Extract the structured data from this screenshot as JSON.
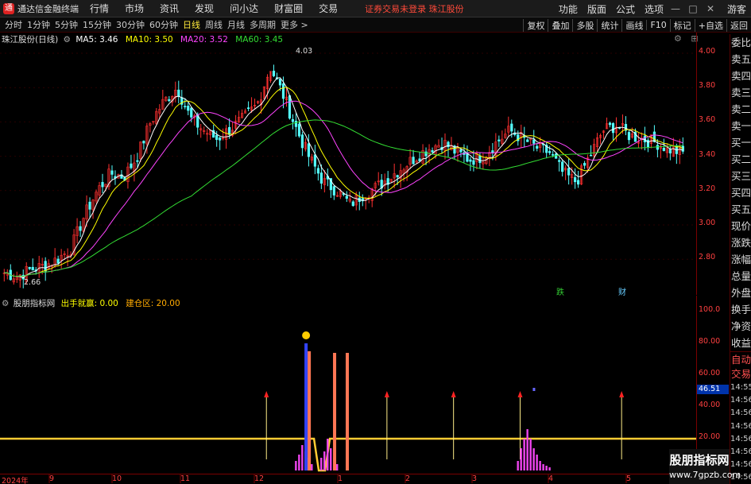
{
  "menubar": {
    "app_title": "通达信金融终端",
    "menus": [
      "行情",
      "市场",
      "资讯",
      "发现",
      "问小达",
      "财富圈",
      "交易"
    ],
    "warning": "证券交易未登录  珠江股份",
    "right_menus": [
      "功能",
      "版面",
      "公式",
      "选项",
      "游客"
    ],
    "window_buttons": [
      "—",
      "□",
      "✕"
    ]
  },
  "toolbar": {
    "periods": [
      "分时",
      "1分钟",
      "5分钟",
      "15分钟",
      "30分钟",
      "60分钟",
      "日线",
      "周线",
      "月线",
      "多周期",
      "更多 >"
    ],
    "active_period": "日线",
    "tools": [
      "复权",
      "叠加",
      "多股",
      "统计",
      "画线",
      "F10",
      "标记",
      "+自选",
      "返回"
    ]
  },
  "main_chart": {
    "stock_label": "珠江股份(日线)",
    "ma": [
      {
        "label": "MA5: 3.46",
        "color": "#ffffff"
      },
      {
        "label": "MA10: 3.50",
        "color": "#ffff00"
      },
      {
        "label": "MA20: 3.52",
        "color": "#ff44ff"
      },
      {
        "label": "MA60: 3.45",
        "color": "#33dd33"
      }
    ],
    "y_ticks": [
      "4.00",
      "3.80",
      "3.60",
      "3.40",
      "3.20",
      "3.00",
      "2.80"
    ],
    "high_note": "4.03",
    "low_note": "2.66",
    "markers": [
      "跌",
      "财"
    ],
    "corner_icons": [
      "⚙",
      "⊞"
    ]
  },
  "indicator": {
    "label": "股朋指标网",
    "value1": "出手就赢: 0.00",
    "value2": "建仓区: 20.00",
    "y_ticks": [
      "100.0",
      "80.00",
      "60.00",
      "40.00",
      "20.00"
    ],
    "current_value": "46.51",
    "bag_icon": "money-bag-icon"
  },
  "x_axis": {
    "labels": [
      "2024年",
      "9",
      "10",
      "11",
      "12",
      "1",
      "2",
      "3",
      "4",
      "5"
    ]
  },
  "side_panel": {
    "items": [
      "委比",
      "卖五",
      "卖四",
      "卖三",
      "卖二",
      "卖一",
      "买一",
      "买二",
      "买三",
      "买四",
      "买五",
      "现价",
      "涨跌",
      "涨幅",
      "总量",
      "外盘",
      "换手",
      "净资",
      "收益"
    ],
    "auto_trade": [
      "自动",
      "交易"
    ],
    "times": [
      "14:55",
      "14:56",
      "14:56",
      "14:56",
      "14:56",
      "14:56",
      "14:56",
      "14:56",
      "14:56",
      "14:56",
      "14:56"
    ]
  },
  "watermark": {
    "title": "股朋指标网",
    "url": "www.7gpzb.com"
  },
  "chart_data": {
    "type": "candlestick",
    "ohlc_sample_close": [
      2.72,
      2.7,
      2.74,
      2.76,
      2.8,
      2.86,
      3.05,
      3.2,
      3.3,
      3.28,
      3.4,
      3.6,
      3.72,
      3.8,
      3.62,
      3.55,
      3.5,
      3.56,
      3.62,
      3.7,
      3.92,
      3.75,
      3.55,
      3.38,
      3.25,
      3.2,
      3.12,
      3.18,
      3.22,
      3.28,
      3.34,
      3.4,
      3.45,
      3.48,
      3.42,
      3.38,
      3.4,
      3.48,
      3.55,
      3.5,
      3.45,
      3.42,
      3.3,
      3.25,
      3.4,
      3.55,
      3.58,
      3.52,
      3.5,
      3.48,
      3.44,
      3.42
    ],
    "indicator_series": {
      "baseline": 20.0,
      "current": 46.51
    }
  }
}
